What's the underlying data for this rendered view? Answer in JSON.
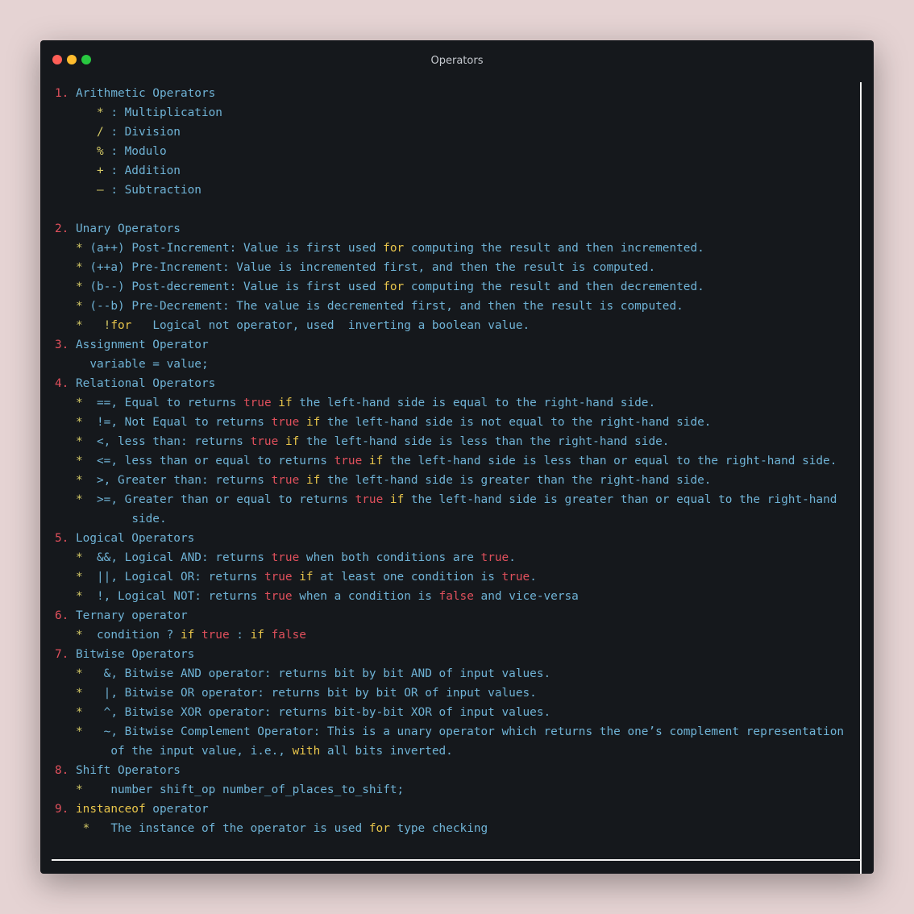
{
  "window": {
    "title": "Operators"
  },
  "colors": {
    "background": "#e5d3d3",
    "window": "#15181c",
    "text": "#6fb3d6",
    "number": "#e0505c",
    "symbol": "#d4c966",
    "keyword": "#e8c54b",
    "boolean": "#e0505c"
  },
  "lines": [
    {
      "num": "1.",
      "text": "Arithmetic Operators"
    },
    {
      "pre": "      ",
      "sym": "*",
      "text": " : Multiplication"
    },
    {
      "pre": "      ",
      "sym": "/",
      "text": " : Division"
    },
    {
      "pre": "      ",
      "sym": "%",
      "text": " : Modulo"
    },
    {
      "pre": "      ",
      "sym": "+",
      "text": " : Addition"
    },
    {
      "pre": "      ",
      "sym": "–",
      "text": " : Subtraction"
    },
    {
      "text": ""
    },
    {
      "num": "2.",
      "text": "Unary Operators"
    },
    {
      "pre": "   ",
      "sym": "*",
      "text": " (a++) Post-Increment: Value is first used ",
      "kw": "for",
      "text2": " computing the result and then incremented."
    },
    {
      "pre": "   ",
      "sym": "*",
      "text": " (++a) Pre-Increment: Value is incremented first, and then the result is computed."
    },
    {
      "pre": "   ",
      "sym": "*",
      "text": " (b--) Post-decrement: Value is first used ",
      "kw": "for",
      "text2": " computing the result and then decremented."
    },
    {
      "pre": "   ",
      "sym": "*",
      "text": " (--b) Pre-Decrement: The value is decremented first, and then the result is computed."
    },
    {
      "pre": "   ",
      "sym": "*",
      "text": "   ",
      "sym2": "!",
      "text2": "   Logical not operator, used ",
      "kw": "for",
      "text3": " inverting a boolean value."
    },
    {
      "num": "3.",
      "text": "Assignment Operator"
    },
    {
      "pre": "     ",
      "text": "variable = value;"
    },
    {
      "num": "4.",
      "text": "Relational Operators"
    },
    {
      "pre": "   ",
      "sym": "*",
      "text": "  ==, Equal to returns ",
      "bool": "true",
      "kw": "if",
      "text2": " the left-hand side is equal to the right-hand side."
    },
    {
      "pre": "   ",
      "sym": "*",
      "text": "  !=, Not Equal to returns ",
      "bool": "true",
      "kw": "if",
      "text2": " the left-hand side is not equal to the right-hand side."
    },
    {
      "pre": "   ",
      "sym": "*",
      "text": "  <, less than: returns ",
      "bool": "true",
      "kw": "if",
      "text2": " the left-hand side is less than the right-hand side."
    },
    {
      "pre": "   ",
      "sym": "*",
      "text": "  <=, less than or equal to returns ",
      "bool": "true",
      "kw": "if",
      "text2": " the left-hand side is less than or equal to the right-hand side."
    },
    {
      "pre": "   ",
      "sym": "*",
      "text": "  >, Greater than: returns ",
      "bool": "true",
      "kw": "if",
      "text2": " the left-hand side is greater than the right-hand side."
    },
    {
      "pre": "   ",
      "sym": "*",
      "text": "  >=, Greater than or equal to returns ",
      "bool": "true",
      "kw": "if",
      "text2": " the left-hand side is greater than or equal to the right-hand"
    },
    {
      "pre": "           ",
      "text": "side."
    },
    {
      "num": "5.",
      "text": "Logical Operators"
    },
    {
      "pre": "   ",
      "sym": "*",
      "text": "  &&, Logical AND: returns ",
      "bool": "true",
      "text2": " when both conditions are ",
      "bool2": "true",
      "text3": "."
    },
    {
      "pre": "   ",
      "sym": "*",
      "text": "  ||, Logical OR: returns ",
      "bool": "true",
      "kw": "if",
      "text2": " at least one condition is ",
      "bool2": "true",
      "text3": "."
    },
    {
      "pre": "   ",
      "sym": "*",
      "text": "  !, Logical NOT: returns ",
      "bool": "true",
      "text2": " when a condition is ",
      "bool2": "false",
      "text3": " and vice-versa"
    },
    {
      "num": "6.",
      "text": "Ternary operator"
    },
    {
      "pre": "   ",
      "sym": "*",
      "text": "  condition ? ",
      "kw": "if",
      "bool": "true",
      "text2": " : ",
      "kw2": "if",
      "bool2": "false"
    },
    {
      "num": "7.",
      "text": "Bitwise Operators"
    },
    {
      "pre": "   ",
      "sym": "*",
      "text": "   &, Bitwise AND operator: returns bit by bit AND of input values."
    },
    {
      "pre": "   ",
      "sym": "*",
      "text": "   |, Bitwise OR operator: returns bit by bit OR of input values."
    },
    {
      "pre": "   ",
      "sym": "*",
      "text": "   ^, Bitwise XOR operator: returns bit-by-bit XOR of input values."
    },
    {
      "pre": "   ",
      "sym": "*",
      "text": "   ~, Bitwise Complement Operator: This is a unary operator which returns the one’s complement representation"
    },
    {
      "pre": "        ",
      "text": "of the input value, i.e., ",
      "kw": "with",
      "text2": " all bits inverted."
    },
    {
      "num": "8.",
      "text": "Shift Operators"
    },
    {
      "pre": "   ",
      "sym": "*",
      "text": "    number shift_op number_of_places_to_shift;"
    },
    {
      "num": "9.",
      "kw": "instanceof",
      "text": " operator"
    },
    {
      "pre": "    ",
      "sym": "*",
      "text": "   The instance of the operator is used ",
      "kw": "for",
      "text2": " type checking"
    }
  ]
}
